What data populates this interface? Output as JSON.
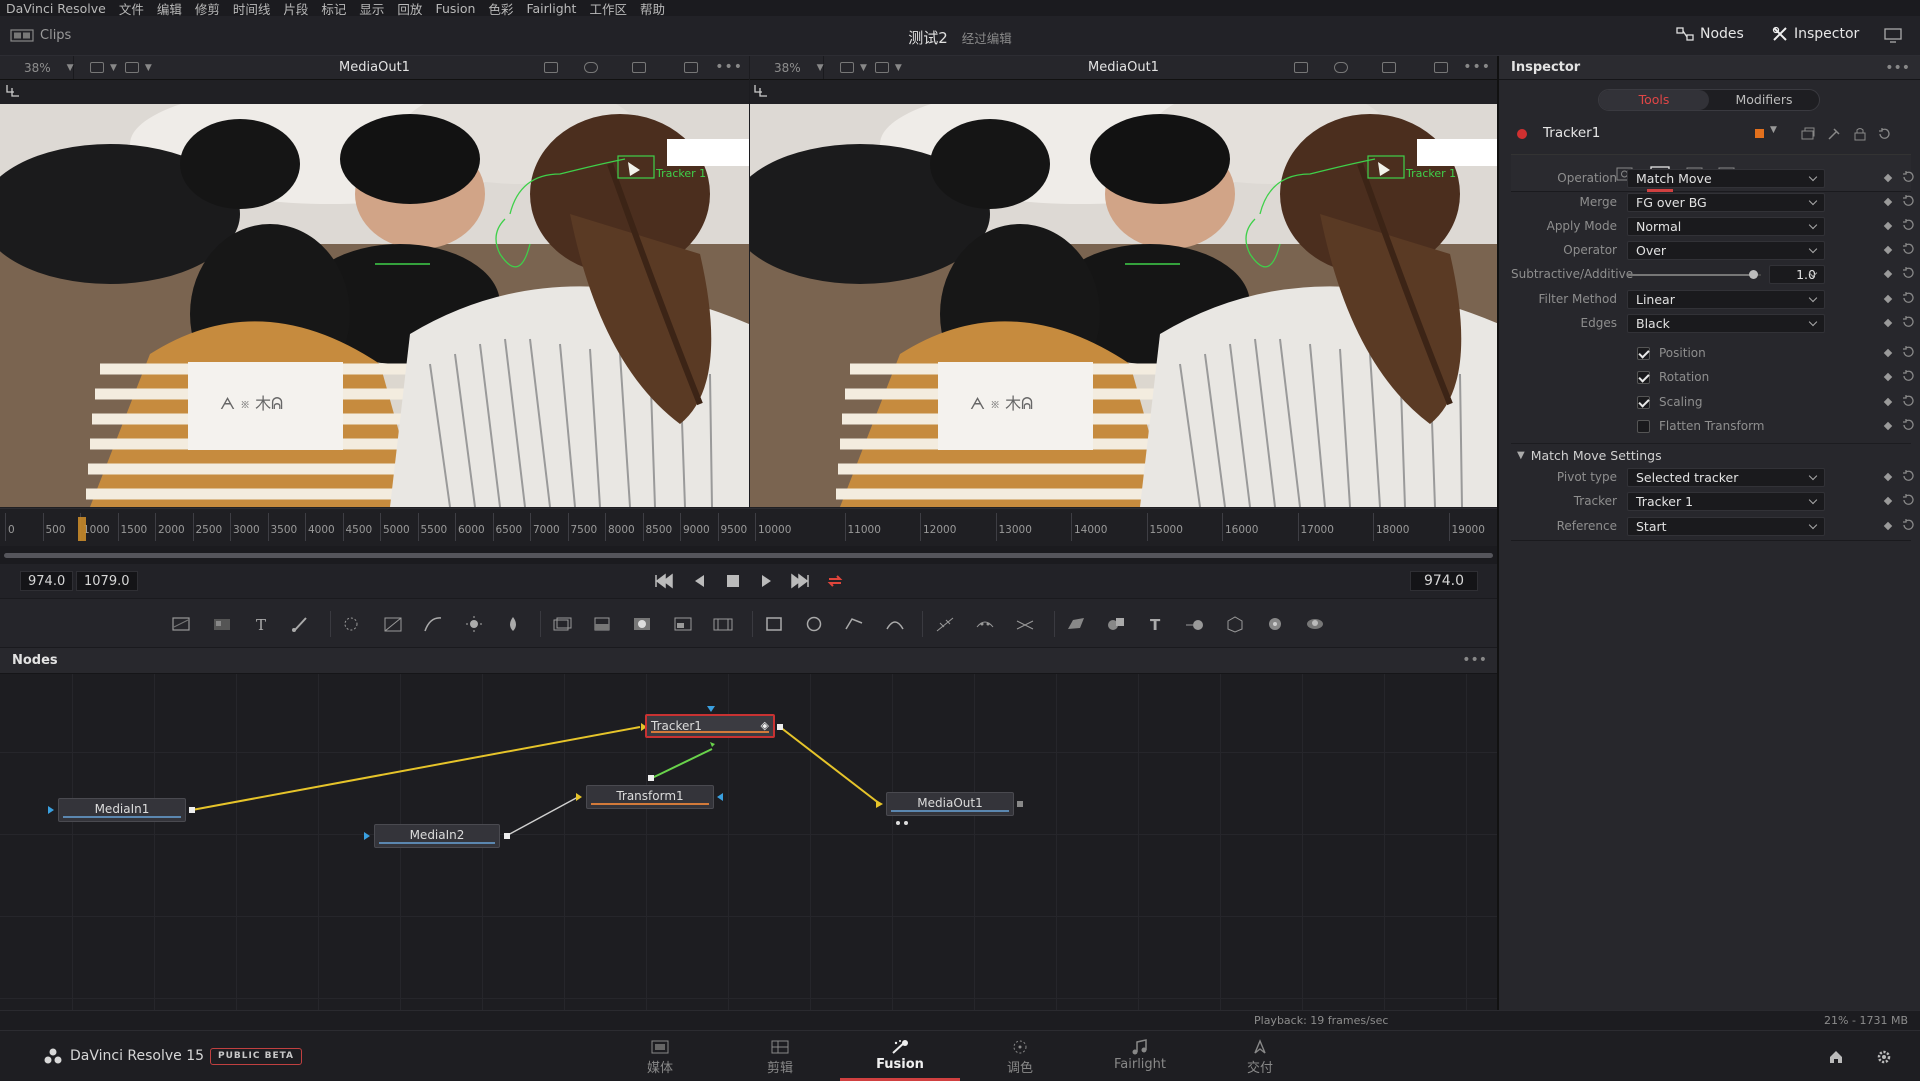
{
  "menubar": [
    "DaVinci Resolve",
    "文件",
    "编辑",
    "修剪",
    "时间线",
    "片段",
    "标记",
    "显示",
    "回放",
    "Fusion",
    "色彩",
    "Fairlight",
    "工作区",
    "帮助"
  ],
  "topbar": {
    "clips": "Clips",
    "project_title": "测试2",
    "project_sub": "经过编辑",
    "nodes_label": "Nodes",
    "inspector_label": "Inspector"
  },
  "viewer_left": {
    "zoom": "38%",
    "title": "MediaOut1",
    "overlay_label": "Tracker 1"
  },
  "viewer_right": {
    "zoom": "38%",
    "title": "MediaOut1",
    "overlay_label": "Tracker 1"
  },
  "ruler": {
    "ticks": [
      "0",
      "500",
      "1000",
      "1500",
      "2000",
      "2500",
      "3000",
      "3500",
      "4000",
      "4500",
      "5000",
      "5500",
      "6000",
      "6500",
      "7000",
      "7500",
      "8000",
      "8500",
      "9000",
      "9500",
      "10000",
      "11000",
      "12000",
      "13000",
      "14000",
      "15000",
      "16000",
      "17000",
      "18000",
      "19000"
    ],
    "playhead_frame": 974
  },
  "transport": {
    "in_time": "974.0",
    "out_time": "1079.0",
    "current_time": "974.0"
  },
  "nodes_panel": {
    "title": "Nodes",
    "nodes": {
      "tracker": "Tracker1",
      "mediain1": "MediaIn1",
      "mediain2": "MediaIn2",
      "transform": "Transform1",
      "mediaout": "MediaOut1"
    }
  },
  "status": {
    "playback": "Playback: 19 frames/sec",
    "memory": "21% - 1731 MB"
  },
  "pagebar": {
    "brand": "DaVinci Resolve 15",
    "beta": "PUBLIC BETA",
    "tabs": [
      "媒体",
      "剪辑",
      "Fusion",
      "调色",
      "Fairlight",
      "交付"
    ],
    "active_tab": "Fusion"
  },
  "inspector": {
    "title": "Inspector",
    "tabs": [
      "Tools",
      "Modifiers"
    ],
    "active_tab": "Tools",
    "tool_name": "Tracker1",
    "params": [
      {
        "label": "Operation",
        "value": "Match Move"
      },
      {
        "label": "Merge",
        "value": "FG over BG"
      },
      {
        "label": "Apply Mode",
        "value": "Normal"
      },
      {
        "label": "Operator",
        "value": "Over"
      }
    ],
    "slider": {
      "label": "Subtractive/Additive",
      "value": "1.0",
      "fraction": 1.0
    },
    "params2": [
      {
        "label": "Filter Method",
        "value": "Linear"
      },
      {
        "label": "Edges",
        "value": "Black"
      }
    ],
    "checks": [
      {
        "label": "Position",
        "checked": true
      },
      {
        "label": "Rotation",
        "checked": true
      },
      {
        "label": "Scaling",
        "checked": true
      },
      {
        "label": "Flatten Transform",
        "checked": false
      }
    ],
    "section": "Match Move Settings",
    "settings": [
      {
        "label": "Pivot type",
        "value": "Selected tracker"
      },
      {
        "label": "Tracker",
        "value": "Tracker 1"
      },
      {
        "label": "Reference",
        "value": "Start"
      }
    ]
  }
}
